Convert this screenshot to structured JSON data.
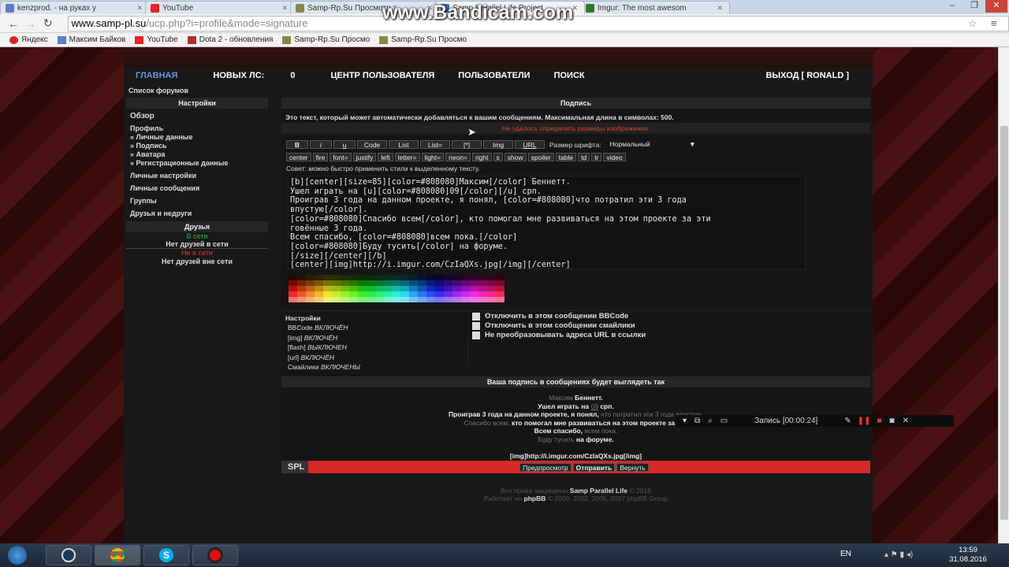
{
  "browser": {
    "tabs": [
      {
        "title": "kenzprod. - на руках у"
      },
      {
        "title": "YouTube"
      },
      {
        "title": "Samp-Rp.Su Просмотр т"
      },
      {
        "title": "Samp Parallel Life Project"
      },
      {
        "title": "Imgur: The most awesom"
      }
    ],
    "url_domain": "www.samp-pl.su",
    "url_path": "/ucp.php?i=profile&mode=signature",
    "bookmarks": [
      "Яндекс",
      "Максим Байков",
      "YouTube",
      "Dota 2 - обновления",
      "Samp-Rp.Su Просмо",
      "Samp-Rp.Su Просмо"
    ]
  },
  "watermark": "www.Bandicam.com",
  "nav": {
    "home": "ГЛАВНАЯ",
    "new_pm": "НОВЫХ ЛС:",
    "new_pm_count": "0",
    "ucp": "ЦЕНТР ПОЛЬЗОВАТЕЛЯ",
    "members": "ПОЛЬЗОВАТЕЛИ",
    "search": "ПОИСК",
    "logout": "ВЫХОД [ RONALD ]"
  },
  "breadcrumb": "Список форумов",
  "sidebar": {
    "settings_header": "Настройки",
    "overview": "Обзор",
    "profile": "Профиль",
    "profile_items": [
      "» Личные данные",
      "» Подпись",
      "» Аватара",
      "» Регистрационные данные"
    ],
    "personal_settings": "Личные настройки",
    "private_messages": "Личные сообщения",
    "groups": "Группы",
    "friends_foes": "Друзья и недруги",
    "friends_header": "Друзья",
    "online": "В сети",
    "no_online": "Нет друзей в сети",
    "offline": "Не в сети",
    "no_offline": "Нет друзей вне сети"
  },
  "signature": {
    "header": "Подпись",
    "desc": "Это текст, который может автоматически добавляться к вашим сообщениям. Максимальная длина в символах: 500.",
    "error": "Не удалось определить размеры изображения.",
    "toolbar1": [
      "B",
      "i",
      "u",
      "Code",
      "List",
      "List=",
      "[*]",
      "Img",
      "URL"
    ],
    "font_size_label": "Размер шрифта:",
    "font_size_value": "Нормальный",
    "toolbar2": [
      "center",
      "fire",
      "font=",
      "justify",
      "left",
      "letter=",
      "light=",
      "neon=",
      "right",
      "s",
      "show",
      "spoiler",
      "table",
      "td",
      "tr",
      "video"
    ],
    "tip": "Совет: можно быстро применить стили к выделенному тексту.",
    "text": "[b][center][size=85][color=#808080]Максим[/color] Беннетт.\nУшел играть на [u][color=#808080]09[/color][/u] срп.\nПроиграв 3 года на данном проекте, я понял, [color=#808080]что потратил эти 3 года\nвпустую[/color].\n[color=#808080]Спасибо всем[/color], кто помогал мне развиваться на этом проекте за эти\nговённые 3 года.\nВсем спасибо, [color=#808080]всем пока.[/color]\n[color=#808080]Буду тусить[/color] на форуме.\n[/size][/center][/b]\n[center][img]http://i.imgur.com/CzIaQXs.jpg[/img][/center]"
  },
  "options": {
    "header": "Настройки",
    "status": [
      {
        "label": "BBCode",
        "state": "ВКЛЮЧЁН"
      },
      {
        "label": "[img]",
        "state": "ВКЛЮЧЁН"
      },
      {
        "label": "[flash]",
        "state": "ВЫКЛЮЧЕН"
      },
      {
        "label": "[url]",
        "state": "ВКЛЮЧЁН"
      },
      {
        "label": "Смайлики",
        "state": "ВКЛЮЧЕНЫ"
      }
    ],
    "checks": [
      "Отключить в этом сообщении BBCode",
      "Отключить в этом сообщении смайлики",
      "Не преобразовывать адреса URL в ссылки"
    ]
  },
  "preview": {
    "header": "Ваша подпись в сообщениях будет выглядеть так",
    "l1a": "Максим",
    "l1b": "Беннетт.",
    "l2a": "Ушел играть на",
    "l2b": "09",
    "l2c": "срп.",
    "l3a": "Проиграв 3 года на данном проекте, я понял,",
    "l3b": "что потратил эти 3 года впустую.",
    "l4a": "Спасибо всем,",
    "l4b": "кто помогал мне развиваться на этом проекте за эти",
    "l5a": "Всем спасибо,",
    "l5b": "всем пока.",
    "l6a": "Буду тусить",
    "l6b": "на форуме.",
    "img": "[img]http://i.imgur.com/CzIaQXs.jpg[/img]"
  },
  "footer": {
    "logo": "SPL",
    "preview_btn": "Предпросмотр",
    "submit_btn": "Отправить",
    "return_btn": "Вернуть"
  },
  "credits": {
    "l1a": "Все права защищены",
    "l1b": "Samp Parallel Life",
    "l1c": "© 2016",
    "l2a": "Работает на",
    "l2b": "phpBB",
    "l2c": "© 2000, 2002, 2005, 2007 phpBB Group"
  },
  "recorder": {
    "label": "Запись [00:00:24]"
  },
  "taskbar": {
    "lang": "EN",
    "time": "13:59",
    "date": "31.08.2016"
  }
}
